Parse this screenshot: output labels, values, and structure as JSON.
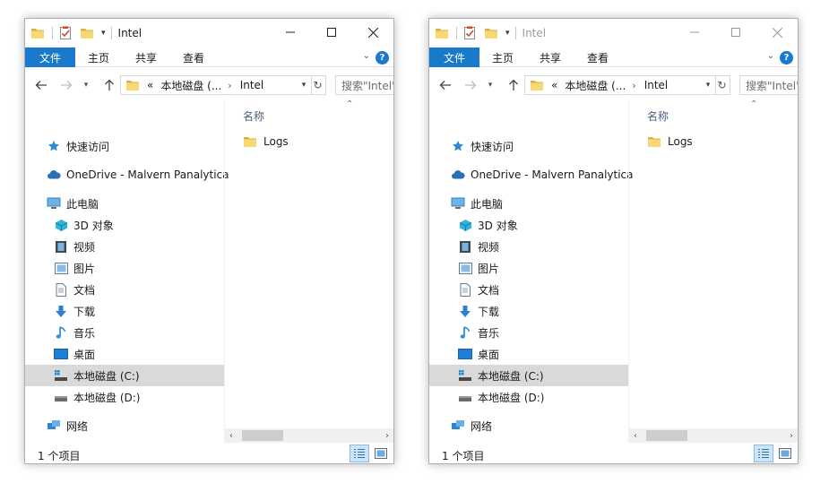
{
  "windows": [
    {
      "title": "Intel",
      "tabs": {
        "file": "文件",
        "home": "主页",
        "share": "共享",
        "view": "查看"
      },
      "address": {
        "overflow": "«",
        "segment1": "本地磁盘 (...",
        "segment2": "Intel"
      },
      "search_placeholder": "搜索\"Intel\"",
      "nav": {
        "quick_access": "快速访问",
        "onedrive": "OneDrive - Malvern Panalytica",
        "this_pc": "此电脑",
        "objects3d": "3D 对象",
        "videos": "视频",
        "pictures": "图片",
        "documents": "文档",
        "downloads": "下载",
        "music": "音乐",
        "desktop": "桌面",
        "drive_c": "本地磁盘 (C:)",
        "drive_d": "本地磁盘 (D:)",
        "network": "网络"
      },
      "column_name": "名称",
      "files": [
        {
          "name": "Logs",
          "type": "folder"
        }
      ],
      "status": "1 个项目",
      "active": true
    },
    {
      "title": "Intel",
      "tabs": {
        "file": "文件",
        "home": "主页",
        "share": "共享",
        "view": "查看"
      },
      "address": {
        "overflow": "«",
        "segment1": "本地磁盘 (...",
        "segment2": "Intel"
      },
      "search_placeholder": "搜索\"Intel\"",
      "nav": {
        "quick_access": "快速访问",
        "onedrive": "OneDrive - Malvern Panalytica",
        "this_pc": "此电脑",
        "objects3d": "3D 对象",
        "videos": "视频",
        "pictures": "图片",
        "documents": "文档",
        "downloads": "下载",
        "music": "音乐",
        "desktop": "桌面",
        "drive_c": "本地磁盘 (C:)",
        "drive_d": "本地磁盘 (D:)",
        "network": "网络"
      },
      "column_name": "名称",
      "files": [
        {
          "name": "Logs",
          "type": "folder"
        }
      ],
      "status": "1 个项目",
      "active": false
    }
  ],
  "colors": {
    "accent": "#1979ca",
    "folder": "#f8d775",
    "selection": "#d9d9d9",
    "inactive_title": "#9a9a9a"
  },
  "icons": [
    "folder-icon",
    "properties-icon",
    "new-folder-icon",
    "minimize-icon",
    "maximize-icon",
    "close-icon",
    "help-icon",
    "back-arrow-icon",
    "forward-arrow-icon",
    "up-arrow-icon",
    "refresh-icon",
    "star-icon",
    "cloud-icon",
    "computer-icon",
    "cube-icon",
    "film-icon",
    "picture-icon",
    "document-icon",
    "download-arrow-icon",
    "music-note-icon",
    "desktop-icon",
    "drive-icon",
    "network-icon",
    "details-view-icon",
    "large-icons-view-icon"
  ]
}
